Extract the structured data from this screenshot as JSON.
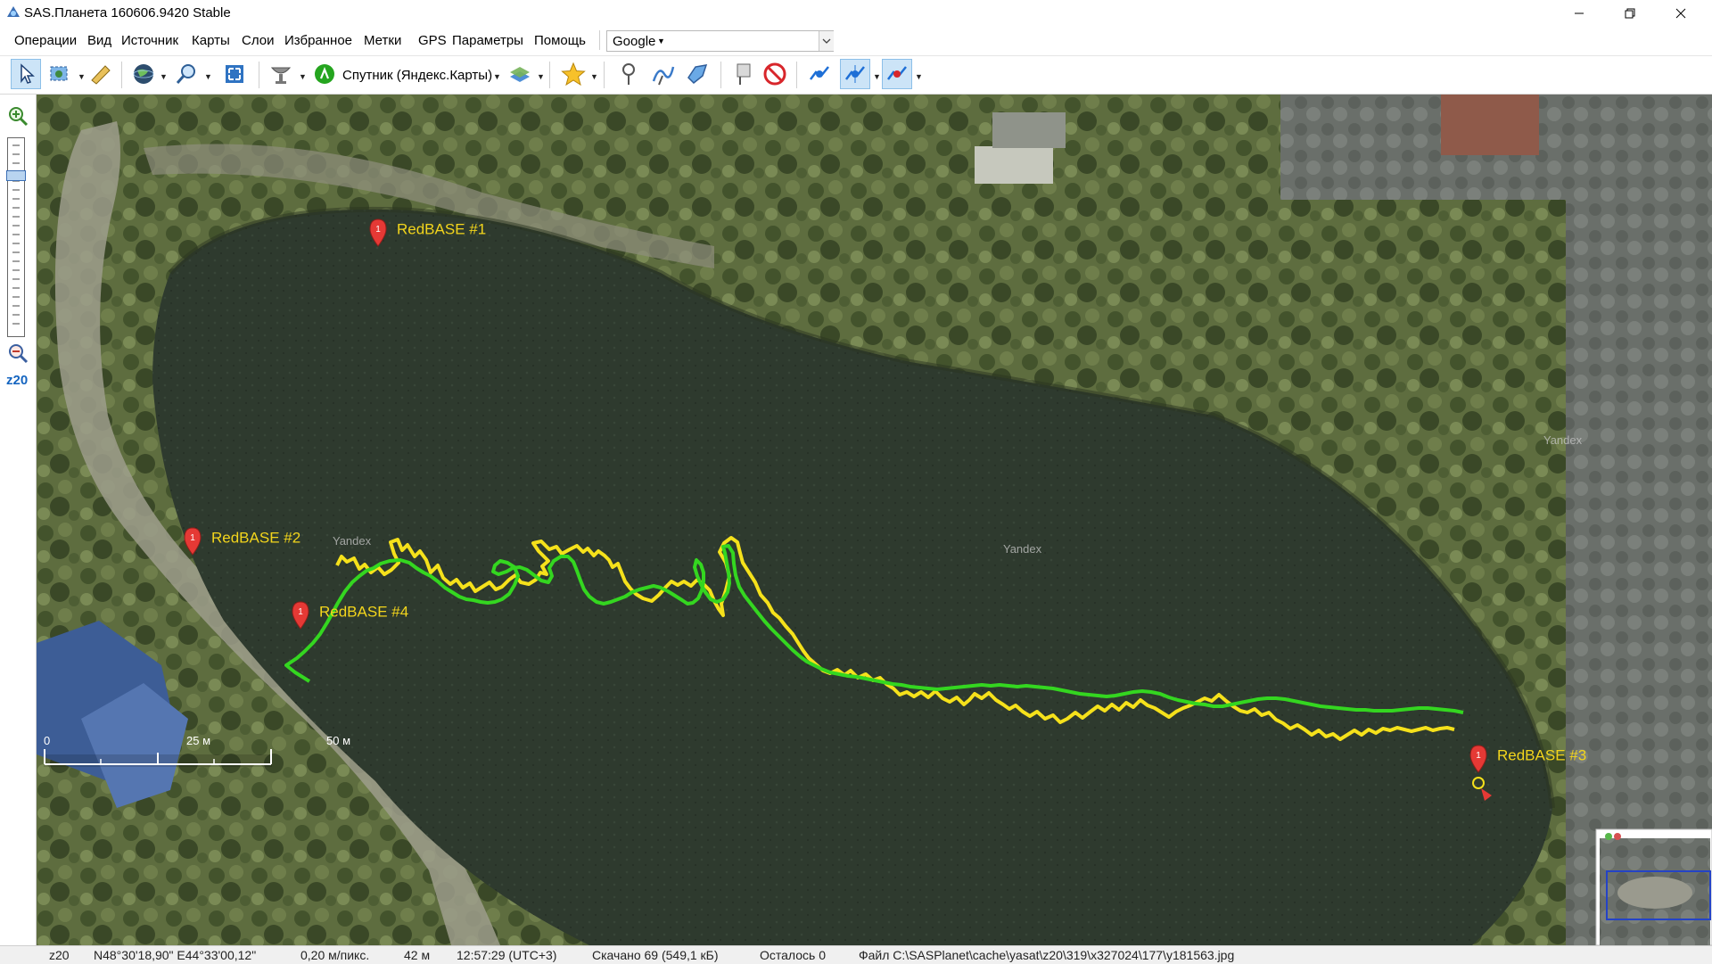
{
  "window": {
    "title": "SAS.Планета 160606.9420 Stable"
  },
  "menu": {
    "items": [
      "Операции",
      "Вид",
      "Источник",
      "Карты",
      "Слои",
      "Избранное",
      "Метки",
      "GPS",
      "Параметры",
      "Помощь"
    ],
    "search_provider": "Google"
  },
  "toolbar": {
    "map_source_label": "Спутник (Яндекс.Карты)",
    "icons": [
      "cursor-arrow",
      "select-area",
      "ruler",
      "globe",
      "zoom-magnifier",
      "fullscreen",
      "satellite-dish",
      "map-source-badge",
      "layers",
      "star",
      "placemark-pin",
      "path-tool",
      "polygon-tool",
      "marks-toggle",
      "no-entry",
      "gps-track",
      "gps-center",
      "gps-follow"
    ]
  },
  "left_panel": {
    "zoom_level": "z20"
  },
  "map": {
    "provider_watermark": "Yandex",
    "placemarks": [
      {
        "label": "RedBASE #1"
      },
      {
        "label": "RedBASE #2"
      },
      {
        "label": "RedBASE #3"
      },
      {
        "label": "RedBASE #4"
      }
    ],
    "scale": {
      "labels": [
        "0",
        "25 м",
        "50 м"
      ]
    },
    "tracks": [
      {
        "color": "#f5e11b"
      },
      {
        "color": "#34d620"
      }
    ]
  },
  "statusbar": {
    "zoom": "z20",
    "coordinates": "N48°30'18,90\" E44°33'00,12\"",
    "resolution": "0,20 м/пикс.",
    "distance": "42 м",
    "time": "12:57:29 (UTC+3)",
    "downloaded": "Скачано 69 (549,1 кБ)",
    "remaining": "Осталось 0",
    "file": "Файл C:\\SASPlanet\\cache\\yasat\\z20\\319\\x327024\\177\\y181563.jpg"
  }
}
